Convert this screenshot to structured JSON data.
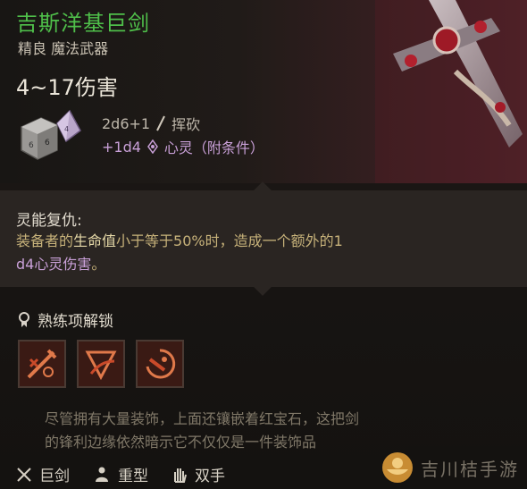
{
  "item": {
    "name": "吉斯洋基巨剑",
    "rarity_type": "精良 魔法武器",
    "damage": "4~17伤害",
    "damage_roll": "2d6+1",
    "damage_type": "挥砍",
    "bonus_roll": "+1d4",
    "bonus_type": "心灵（附条件）"
  },
  "ability": {
    "title": "灵能复仇:",
    "desc_part1": "装备者的",
    "desc_hl": "生命值",
    "desc_part2": "小于等于50%时，造成一个额外的1",
    "desc_part3": "d4心灵伤害",
    "desc_end": "。"
  },
  "proficiency": {
    "title": "熟练项解锁"
  },
  "flavor": {
    "line1": "尽管拥有大量装饰，上面还镶嵌着红宝石，这把剑",
    "line2": "的锋利边缘依然暗示它不仅仅是一件装饰品"
  },
  "tags": [
    {
      "label": "巨剑",
      "icon": "crossed-swords-icon"
    },
    {
      "label": "重型",
      "icon": "heavy-figure-icon"
    },
    {
      "label": "双手",
      "icon": "hand-icon"
    }
  ],
  "watermark": {
    "text": "吉川桔手游"
  },
  "colors": {
    "title_green": "#4fbf4a",
    "psychic_purple": "#c9a0d8",
    "desc_gold": "#c7b27a"
  }
}
